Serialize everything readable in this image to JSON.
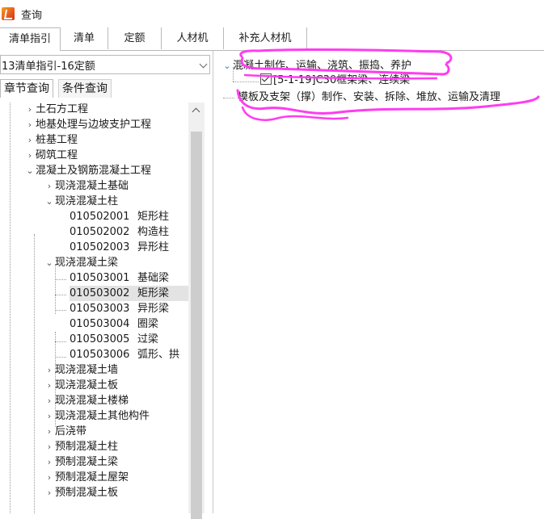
{
  "window": {
    "title": "查询"
  },
  "tabs": [
    "清单指引",
    "清单",
    "定额",
    "人材机",
    "补充人材机"
  ],
  "left": {
    "combo_value": "13清单指引-16定额",
    "subtabs": [
      "章节查询",
      "条件查询"
    ],
    "tree": [
      {
        "label": "土石方工程",
        "expander": "›"
      },
      {
        "label": "地基处理与边坡支护工程",
        "expander": "›"
      },
      {
        "label": "桩基工程",
        "expander": "›"
      },
      {
        "label": "砌筑工程",
        "expander": "›"
      },
      {
        "label": "混凝土及钢筋混凝土工程",
        "expander": "⌄"
      },
      {
        "label": "现浇混凝土基础",
        "expander": "›"
      },
      {
        "label": "现浇混凝土柱",
        "expander": "⌄"
      },
      {
        "code": "010502001",
        "label": "矩形柱"
      },
      {
        "code": "010502002",
        "label": "构造柱"
      },
      {
        "code": "010502003",
        "label": "异形柱"
      },
      {
        "label": "现浇混凝土梁",
        "expander": "⌄"
      },
      {
        "code": "010503001",
        "label": "基础梁"
      },
      {
        "code": "010503002",
        "label": "矩形梁"
      },
      {
        "code": "010503003",
        "label": "异形梁"
      },
      {
        "code": "010503004",
        "label": "圈梁"
      },
      {
        "code": "010503005",
        "label": "过梁"
      },
      {
        "code": "010503006",
        "label": "弧形、拱"
      },
      {
        "label": "现浇混凝土墙",
        "expander": "›"
      },
      {
        "label": "现浇混凝土板",
        "expander": "›"
      },
      {
        "label": "现浇混凝土楼梯",
        "expander": "›"
      },
      {
        "label": "现浇混凝土其他构件",
        "expander": "›"
      },
      {
        "label": "后浇带",
        "expander": "›"
      },
      {
        "label": "预制混凝土柱",
        "expander": "›"
      },
      {
        "label": "预制混凝土梁",
        "expander": "›"
      },
      {
        "label": "预制混凝土屋架",
        "expander": "›"
      },
      {
        "label": "预制混凝土板",
        "expander": "›"
      }
    ]
  },
  "right": {
    "node1": "混凝土制作、运输、浇筑、振捣、养护",
    "child1": "[5-1-19]C30框架梁、连续梁",
    "node2": "模板及支架（撑）制作、安装、拆除、堆放、运输及清理"
  },
  "colors": {
    "highlight": "#ff3cf0",
    "expander_blue": "#2a7bd8",
    "selected_row": "#e3e3e3"
  }
}
